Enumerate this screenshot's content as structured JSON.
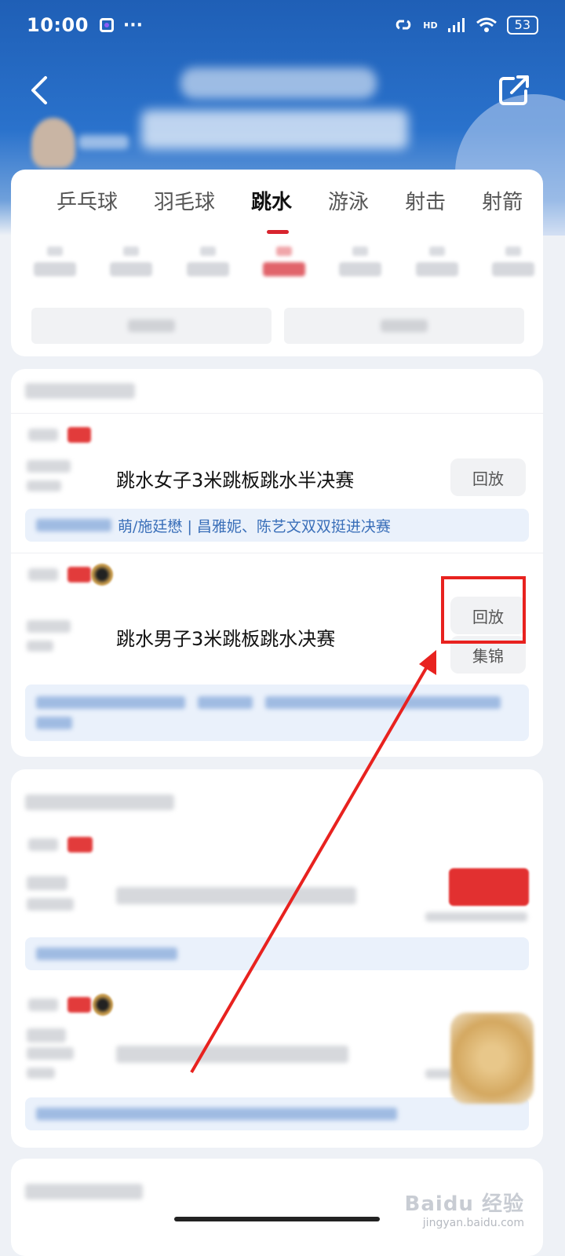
{
  "status_bar": {
    "time": "10:00",
    "dots": "···",
    "network": "HD",
    "battery": "53"
  },
  "header": {
    "back_icon": "back-arrow-icon",
    "share_icon": "share-icon"
  },
  "sports_tabs": [
    {
      "label": "乒乓球",
      "active": false
    },
    {
      "label": "羽毛球",
      "active": false
    },
    {
      "label": "跳水",
      "active": true
    },
    {
      "label": "游泳",
      "active": false
    },
    {
      "label": "射击",
      "active": false
    },
    {
      "label": "射箭",
      "active": false
    }
  ],
  "events": [
    {
      "title": "跳水女子3米跳板跳水半决赛",
      "buttons": [
        "回放"
      ],
      "news": "萌/施廷懋 | 昌雅妮、陈艺文双双挺进决赛"
    },
    {
      "title": "跳水男子3米跳板跳水决赛",
      "buttons": [
        "回放",
        "集锦"
      ],
      "news": ""
    }
  ],
  "watermark": {
    "main": "Baidu 经验",
    "sub": "jingyan.baidu.com"
  },
  "colors": {
    "header_blue": "#1f5fb6",
    "accent_red": "#d8242e",
    "annotation_red": "#e8221f",
    "news_blue": "#3a6fb9"
  }
}
